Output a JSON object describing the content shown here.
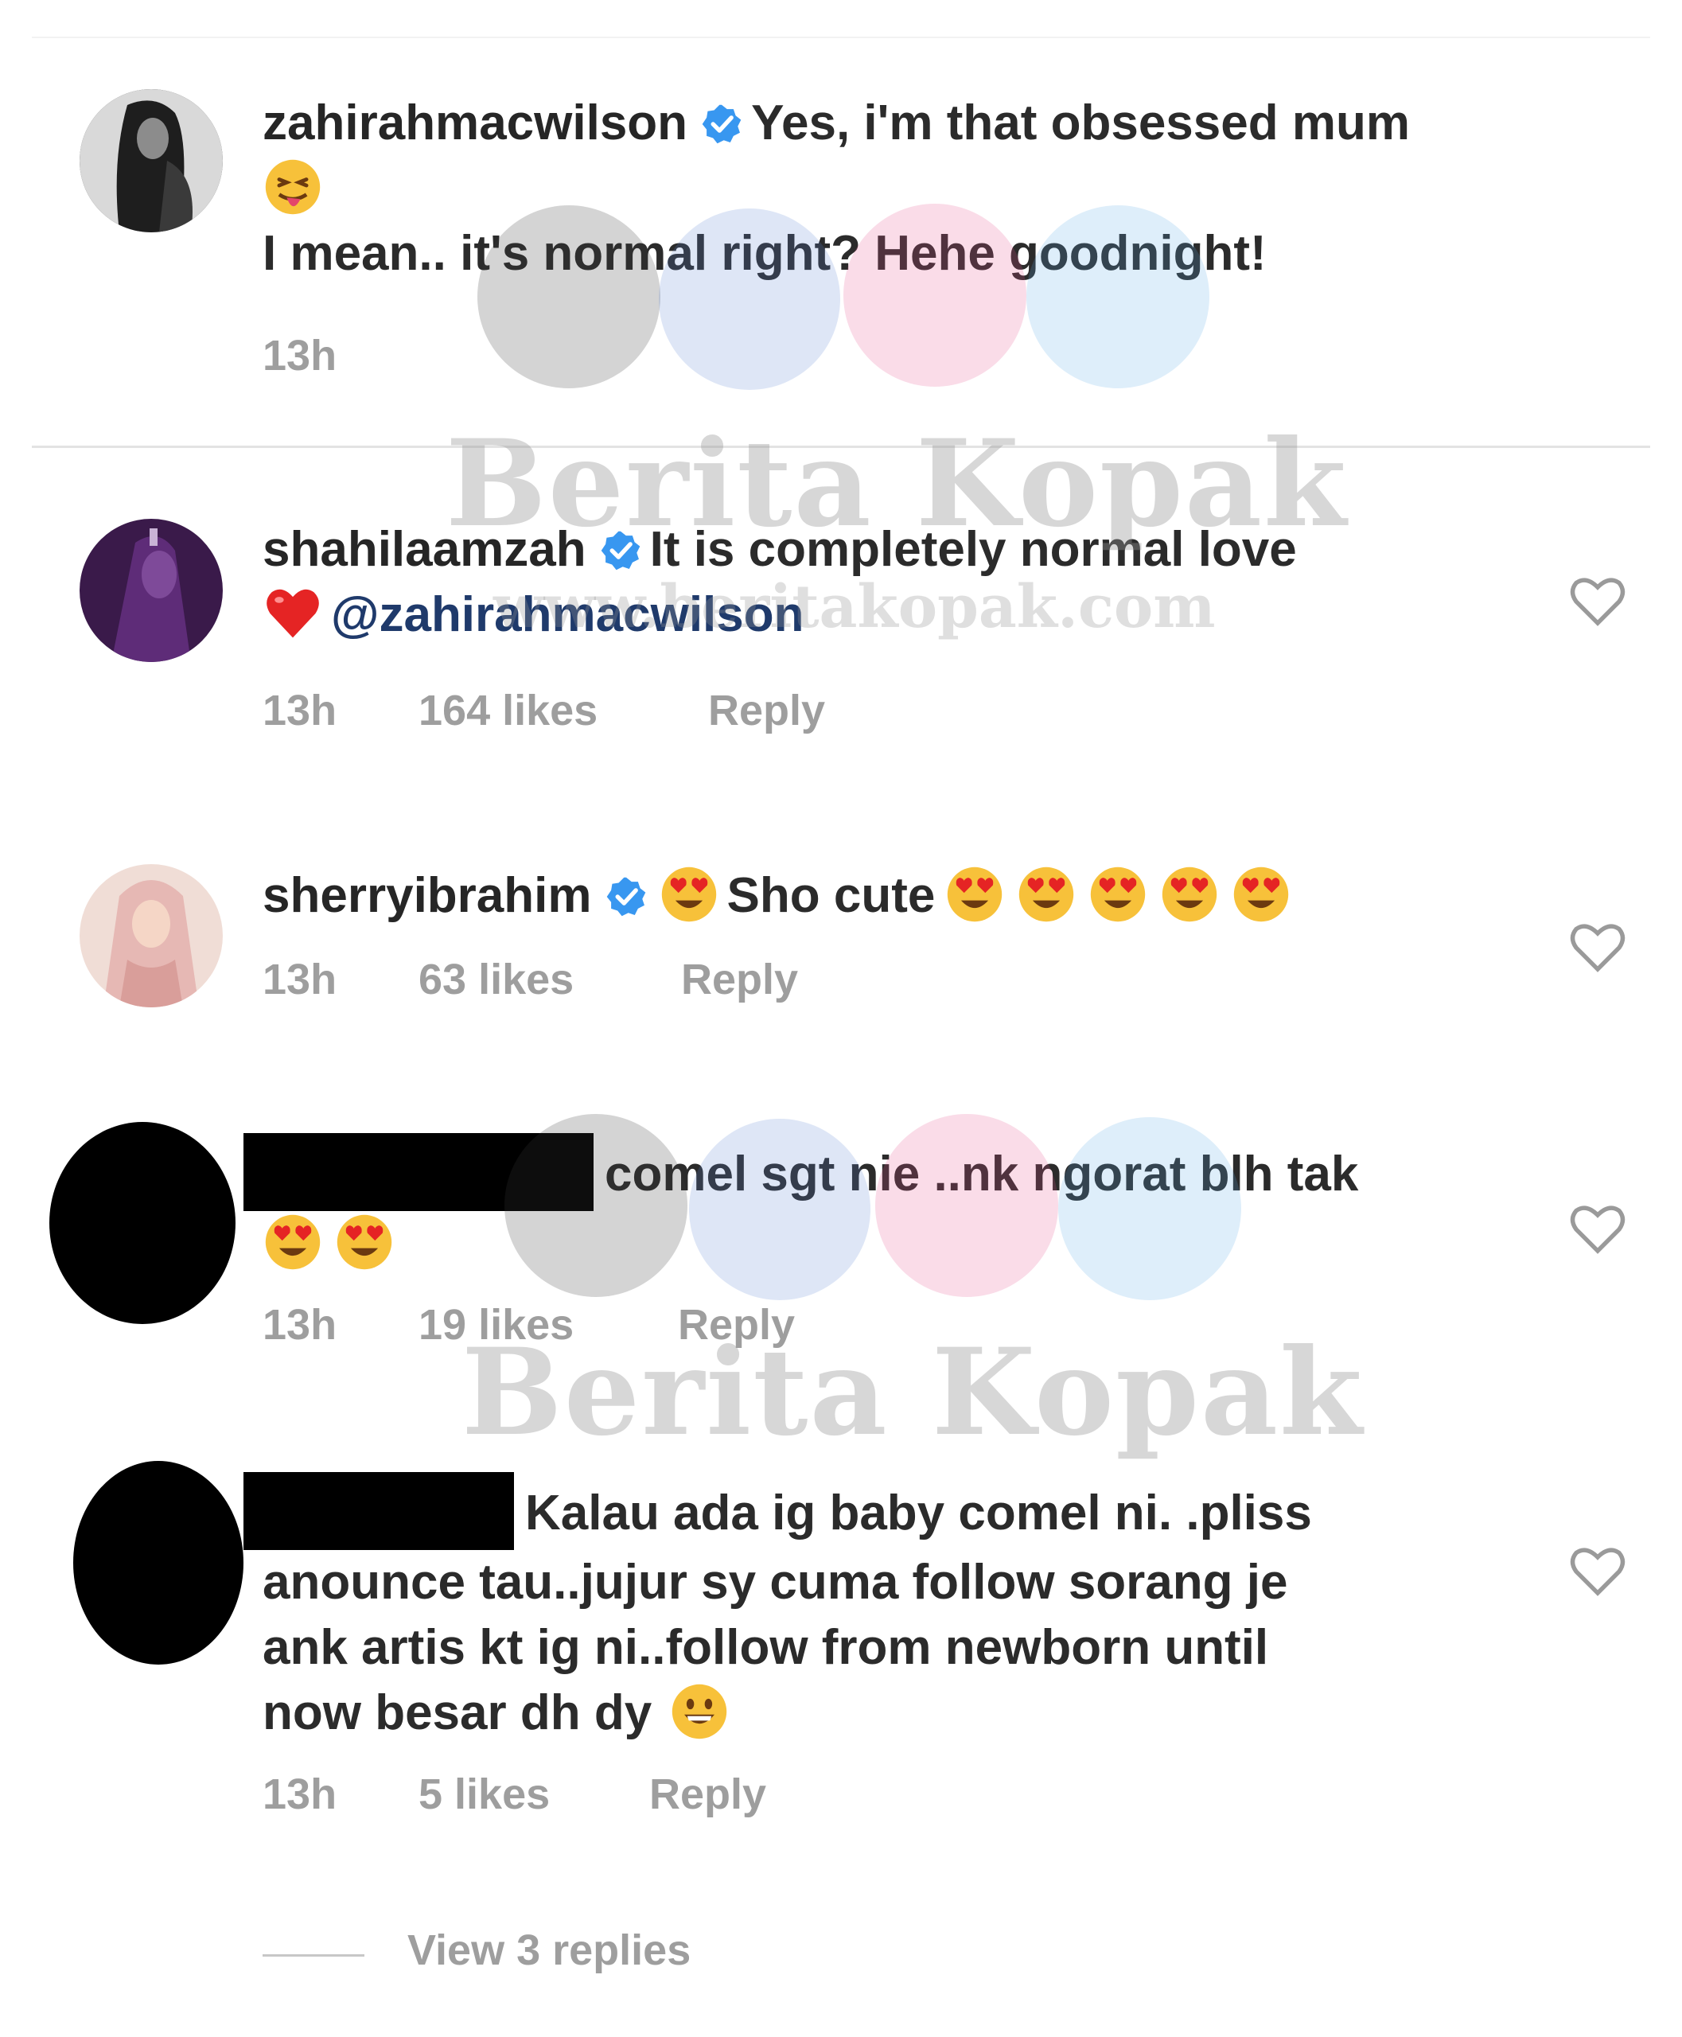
{
  "watermark": {
    "name": "Berita Kopak",
    "url": "www.beritakopak.com"
  },
  "colors": {
    "verified": "#3897f0",
    "meta": "#9e9e9e",
    "text": "#262626",
    "redaction": "#000000"
  },
  "comments": [
    {
      "username": "zahirahmacwilson",
      "verified": true,
      "text1": "Yes, i'm that obsessed mum",
      "emoji1": "tongue-face",
      "text2": "I mean.. it's normal right? Hehe goodnight!",
      "time": "13h"
    },
    {
      "username": "shahilaamzah",
      "verified": true,
      "text1": "It is completely normal love",
      "emoji1": "red-heart",
      "mention": "@zahirahmacwilson",
      "time": "13h",
      "likes": "164 likes",
      "reply": "Reply"
    },
    {
      "username": "sherryibrahim",
      "verified": true,
      "emoji1": "heart-eyes",
      "text1": "Sho cute",
      "emoji_count": 5,
      "time": "13h",
      "likes": "63 likes",
      "reply": "Reply"
    },
    {
      "username_redacted": true,
      "text1": "comel sgt nie ..nk ngorat blh tak",
      "emoji_count": 2,
      "time": "13h",
      "likes": "19 likes",
      "reply": "Reply"
    },
    {
      "username_redacted": true,
      "text1": "Kalau ada ig baby comel  ni. .pliss",
      "text2": "anounce tau..jujur sy cuma follow sorang je",
      "text3": "ank artis kt ig ni..follow from newborn until",
      "text4": "now besar dh dy",
      "emoji1": "grinning-face",
      "time": "13h",
      "likes": "5 likes",
      "reply": "Reply"
    }
  ],
  "view_replies": "View 3 replies"
}
